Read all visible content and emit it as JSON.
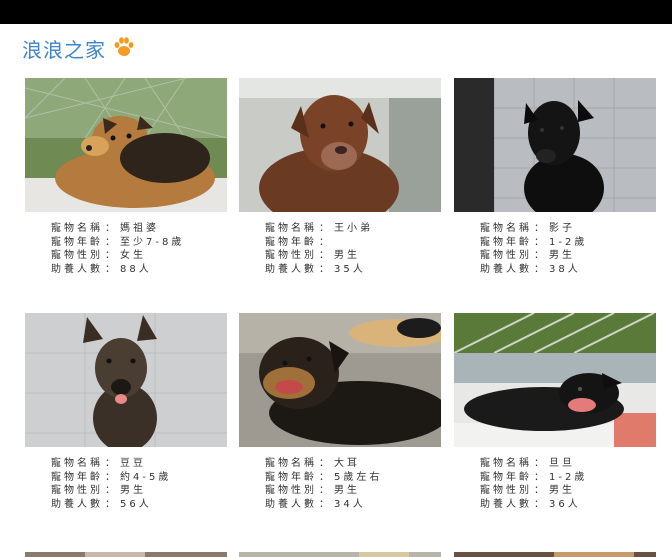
{
  "header": {
    "site_title": "浪浪之家",
    "paw_icon": "paw-icon",
    "accent": "#3f86c8",
    "paw_color": "#f39c21"
  },
  "labels": {
    "name": "寵物名稱",
    "age": "寵物年齡",
    "gender": "寵物性別",
    "sponsors": "助養人數",
    "separator": "："
  },
  "pets": [
    {
      "name": "媽祖婆",
      "age": "至少7-8歲",
      "gender": "女生",
      "sponsors": "88人"
    },
    {
      "name": "王小弟",
      "age": "",
      "gender": "男生",
      "sponsors": "35人"
    },
    {
      "name": "影子",
      "age": "1-2歲",
      "gender": "男生",
      "sponsors": "38人"
    },
    {
      "name": "豆豆",
      "age": "約4-5歲",
      "gender": "男生",
      "sponsors": "56人"
    },
    {
      "name": "大耳",
      "age": "5歲左右",
      "gender": "男生",
      "sponsors": "34人"
    },
    {
      "name": "旦旦",
      "age": "1-2歲",
      "gender": "男生",
      "sponsors": "36人"
    }
  ]
}
